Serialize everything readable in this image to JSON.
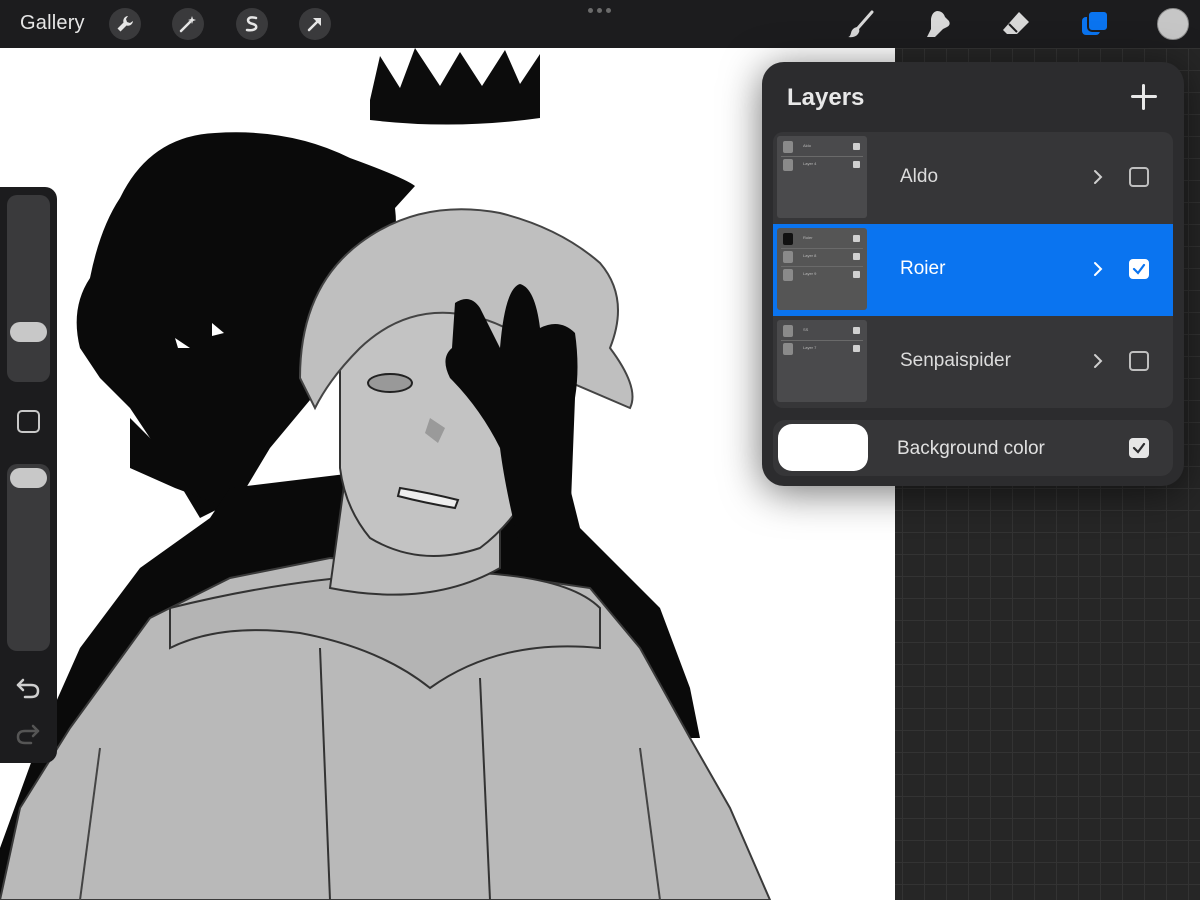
{
  "topbar": {
    "gallery_label": "Gallery",
    "left_tools": [
      "wrench-icon",
      "magic-wand-icon",
      "selection-icon",
      "transform-arrow-icon"
    ],
    "right_tools": [
      "brush-icon",
      "smudge-icon",
      "eraser-icon",
      "layers-icon"
    ],
    "active_tool": "layers-icon",
    "current_color": "#c6c6c6"
  },
  "sidebar": {
    "brush_size_level": 0.74,
    "opacity_level": 1.0,
    "tools": [
      "modify-button",
      "undo-icon",
      "redo-icon"
    ]
  },
  "layers_panel": {
    "title": "Layers",
    "add_icon": "plus-icon",
    "layers": [
      {
        "name": "Aldo",
        "visible": false,
        "selected": false,
        "thumb_labels": [
          "Aldo",
          "Layer 4"
        ]
      },
      {
        "name": "Roier",
        "visible": true,
        "selected": true,
        "thumb_labels": [
          "Roier",
          "Layer 8",
          "Layer 9"
        ]
      },
      {
        "name": "Senpaispider",
        "visible": false,
        "selected": false,
        "thumb_labels": [
          "SS",
          "Layer 7"
        ]
      }
    ],
    "background": {
      "label": "Background color",
      "color": "#ffffff",
      "visible": true
    }
  },
  "colors": {
    "accent": "#0a74f0",
    "panel": "#2c2c2e",
    "toolbar": "#1c1c1e"
  }
}
